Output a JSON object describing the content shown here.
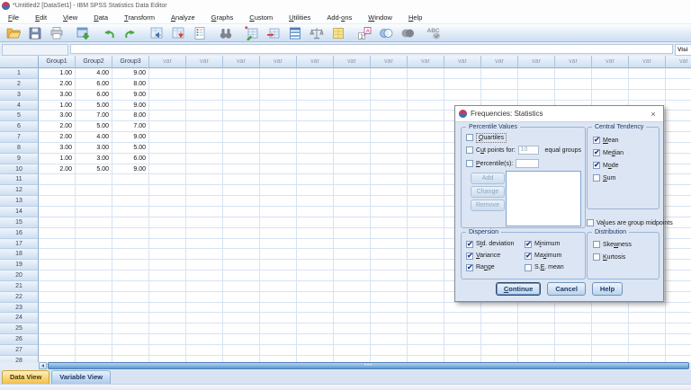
{
  "window": {
    "title": "*Untitled2 [DataSet1] - IBM SPSS Statistics Data Editor"
  },
  "menu_bar": {
    "items": [
      {
        "label": "File",
        "u": 0
      },
      {
        "label": "Edit",
        "u": 0
      },
      {
        "label": "View",
        "u": 0
      },
      {
        "label": "Data",
        "u": 0
      },
      {
        "label": "Transform",
        "u": 0
      },
      {
        "label": "Analyze",
        "u": 0
      },
      {
        "label": "Graphs",
        "u": 0
      },
      {
        "label": "Custom",
        "u": 0
      },
      {
        "label": "Utilities",
        "u": 0
      },
      {
        "label": "Add-ons",
        "u": 4
      },
      {
        "label": "Window",
        "u": 0
      },
      {
        "label": "Help",
        "u": 0
      }
    ]
  },
  "toolbar": {
    "icons": [
      "open-data",
      "save",
      "print",
      "recall-dialogs",
      "undo",
      "redo",
      "goto-case",
      "goto-variable",
      "variables",
      "find",
      "insert-cases",
      "insert-variable",
      "split-file",
      "weight-cases",
      "select-cases",
      "value-labels",
      "use-variable-sets",
      "show-all-variables",
      "spell-check"
    ]
  },
  "edit_row": {
    "cell_reference": "",
    "cell_editor": "",
    "visible_indicator": "Visi"
  },
  "grid": {
    "columns": [
      "Group1",
      "Group2",
      "Group3"
    ],
    "var_header": "var",
    "var_col_count": 15,
    "total_rows": 28,
    "rows": [
      [
        "1.00",
        "4.00",
        "9.00"
      ],
      [
        "2.00",
        "6.00",
        "8.00"
      ],
      [
        "3.00",
        "6.00",
        "9.00"
      ],
      [
        "1.00",
        "5.00",
        "9.00"
      ],
      [
        "3.00",
        "7.00",
        "8.00"
      ],
      [
        "2.00",
        "5.00",
        "7.00"
      ],
      [
        "2.00",
        "4.00",
        "9.00"
      ],
      [
        "3.00",
        "3.00",
        "5.00"
      ],
      [
        "1.00",
        "3.00",
        "6.00"
      ],
      [
        "2.00",
        "5.00",
        "9.00"
      ]
    ]
  },
  "dialog": {
    "title": "Frequencies: Statistics",
    "close_label": "×",
    "percentile_values": {
      "title": "Percentile Values",
      "quartiles": {
        "label": "Quartiles",
        "u": 0,
        "checked": false
      },
      "cut_points": {
        "label": "Cut points for:",
        "u": 1,
        "checked": false
      },
      "cut_points_value": "10",
      "cut_points_suffix": "equal groups",
      "percentiles": {
        "label": "Percentile(s):",
        "u": 0,
        "checked": false
      },
      "percentiles_value": "",
      "add_button": "Add",
      "change_button": "Change",
      "remove_button": "Remove"
    },
    "central_tendency": {
      "title": "Central Tendency",
      "items": [
        {
          "label": "Mean",
          "u": 0,
          "checked": true
        },
        {
          "label": "Median",
          "u": 2,
          "checked": true
        },
        {
          "label": "Mode",
          "u": 1,
          "checked": true
        },
        {
          "label": "Sum",
          "u": 0,
          "checked": false
        }
      ]
    },
    "group_midpoints": {
      "label": "Values are group midpoints",
      "u": 2,
      "checked": false
    },
    "dispersion": {
      "title": "Dispersion",
      "col1": [
        {
          "label": "Std. deviation",
          "u": 1,
          "checked": true
        },
        {
          "label": "Variance",
          "u": 0,
          "checked": true
        },
        {
          "label": "Range",
          "u": 2,
          "checked": true
        }
      ],
      "col2": [
        {
          "label": "Minimum",
          "u": 1,
          "checked": true
        },
        {
          "label": "Maximum",
          "u": 2,
          "checked": true
        },
        {
          "label": "S.E. mean",
          "u": 2,
          "checked": false
        }
      ]
    },
    "distribution": {
      "title": "Distribution",
      "items": [
        {
          "label": "Skewness",
          "u": 3,
          "checked": false
        },
        {
          "label": "Kurtosis",
          "u": 0,
          "checked": false
        }
      ]
    },
    "buttons": {
      "continue": "Continue",
      "cancel": "Cancel",
      "help": "Help"
    }
  },
  "tabs": {
    "data_view": "Data View",
    "variable_view": "Variable View"
  },
  "colors": {
    "accent_blue": "#4a7fc1",
    "tab_active": "#f2bf49",
    "check_navy": "#2b3990",
    "header_text": "#39435c",
    "var_text": "#8e99ad"
  }
}
